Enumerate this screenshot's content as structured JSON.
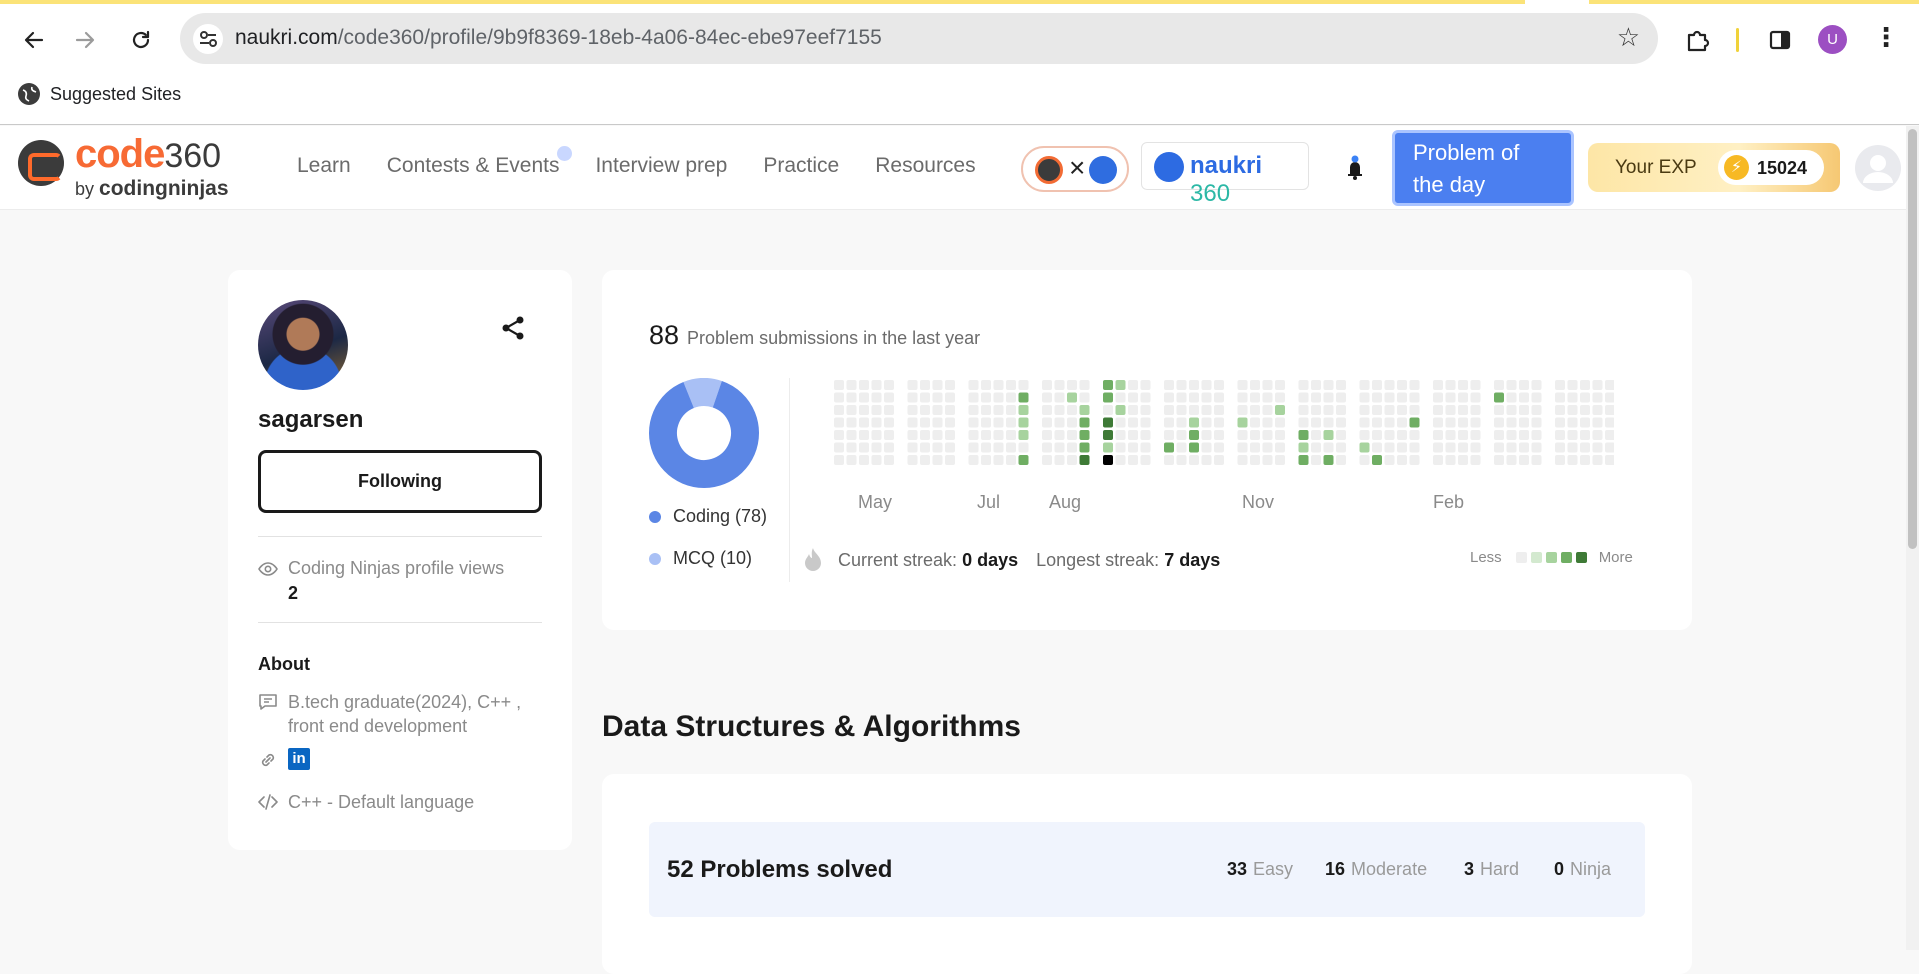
{
  "browser": {
    "url_host": "naukri.com",
    "url_path": "/code360/profile/9b9f8369-18eb-4a06-84ec-ebe97eef7155",
    "profile_initial": "U",
    "bookmarks": [
      {
        "label": "Suggested Sites",
        "icon": "globe-icon"
      }
    ]
  },
  "header": {
    "logo": {
      "code": "code",
      "num": "360",
      "by": "by",
      "brand": "codingninjas"
    },
    "nav": [
      "Learn",
      "Contests & Events",
      "Interview prep",
      "Practice",
      "Resources"
    ],
    "naukri_chip": {
      "naukri": "naukri",
      "num": "360"
    },
    "collab_x": "×",
    "potd_label": "Problem of the day",
    "exp_label": "Your EXP",
    "exp_value": "15024"
  },
  "profile": {
    "username": "sagarsen",
    "follow_label": "Following",
    "views_label": "Coding Ninjas profile views",
    "views_count": "2",
    "about_title": "About",
    "bio": "B.tech graduate(2024), C++ , front end development",
    "linkedin": "in",
    "language": "C++ - Default language"
  },
  "submissions": {
    "count": "88",
    "label": "Problem submissions in the last year",
    "breakdown": [
      {
        "label": "Coding (78)",
        "value": 78,
        "color": "#5b86e5"
      },
      {
        "label": "MCQ (10)",
        "value": 10,
        "color": "#a9c0f5"
      }
    ],
    "months": [
      "May",
      "Jul",
      "Aug",
      "Nov",
      "Feb"
    ],
    "current_streak_label": "Current streak:",
    "current_streak_value": "0 days",
    "longest_streak_label": "Longest streak:",
    "longest_streak_value": "7 days",
    "legend_less": "Less",
    "legend_more": "More",
    "scale_colors": [
      "#eeeeee",
      "#d3e9cf",
      "#a7d39e",
      "#6fae63",
      "#3e7a36"
    ]
  },
  "dsa": {
    "title": "Data Structures & Algorithms",
    "solved": "52 Problems solved",
    "difficulty": [
      {
        "count": "33",
        "label": "Easy"
      },
      {
        "count": "16",
        "label": "Moderate"
      },
      {
        "count": "3",
        "label": "Hard"
      },
      {
        "count": "0",
        "label": "Ninja"
      }
    ]
  }
}
